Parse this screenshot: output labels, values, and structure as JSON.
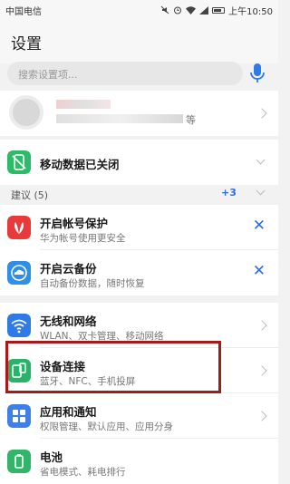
{
  "status": {
    "carrier": "中国电信",
    "time": "上午10:50",
    "icons": [
      "mute-icon",
      "alarm-icon",
      "wifi-icon",
      "signal-icon",
      "battery-icon"
    ]
  },
  "header": {
    "title": "设置"
  },
  "search": {
    "placeholder": "搜索设置项..."
  },
  "account": {
    "suffix": "等"
  },
  "mobile_data": {
    "label": "移动数据已关闭",
    "icon_color": "#2dbb6a"
  },
  "suggestions": {
    "label": "建议 (5)",
    "more": "+3",
    "items": [
      {
        "title": "开启帐号保护",
        "subtitle": "华为帐号使用更安全",
        "icon_color": "#e83a3a"
      },
      {
        "title": "开启云备份",
        "subtitle": "自动备份数据，随时恢复",
        "icon_color": "#2e8fe8"
      }
    ]
  },
  "settings": [
    {
      "title": "无线和网络",
      "subtitle": "WLAN、双卡管理、移动网络",
      "icon_color": "#2e7be8",
      "icon": "wifi-icon"
    },
    {
      "title": "设备连接",
      "subtitle": "蓝牙、NFC、手机投屏",
      "icon_color": "#27b36a",
      "icon": "device-connect-icon"
    },
    {
      "title": "应用和通知",
      "subtitle": "权限管理、默认应用、应用分身",
      "icon_color": "#3f7fe6",
      "icon": "apps-icon"
    },
    {
      "title": "电池",
      "subtitle": "省电模式、耗电排行",
      "icon_color": "#33b46b",
      "icon": "battery-icon"
    }
  ]
}
